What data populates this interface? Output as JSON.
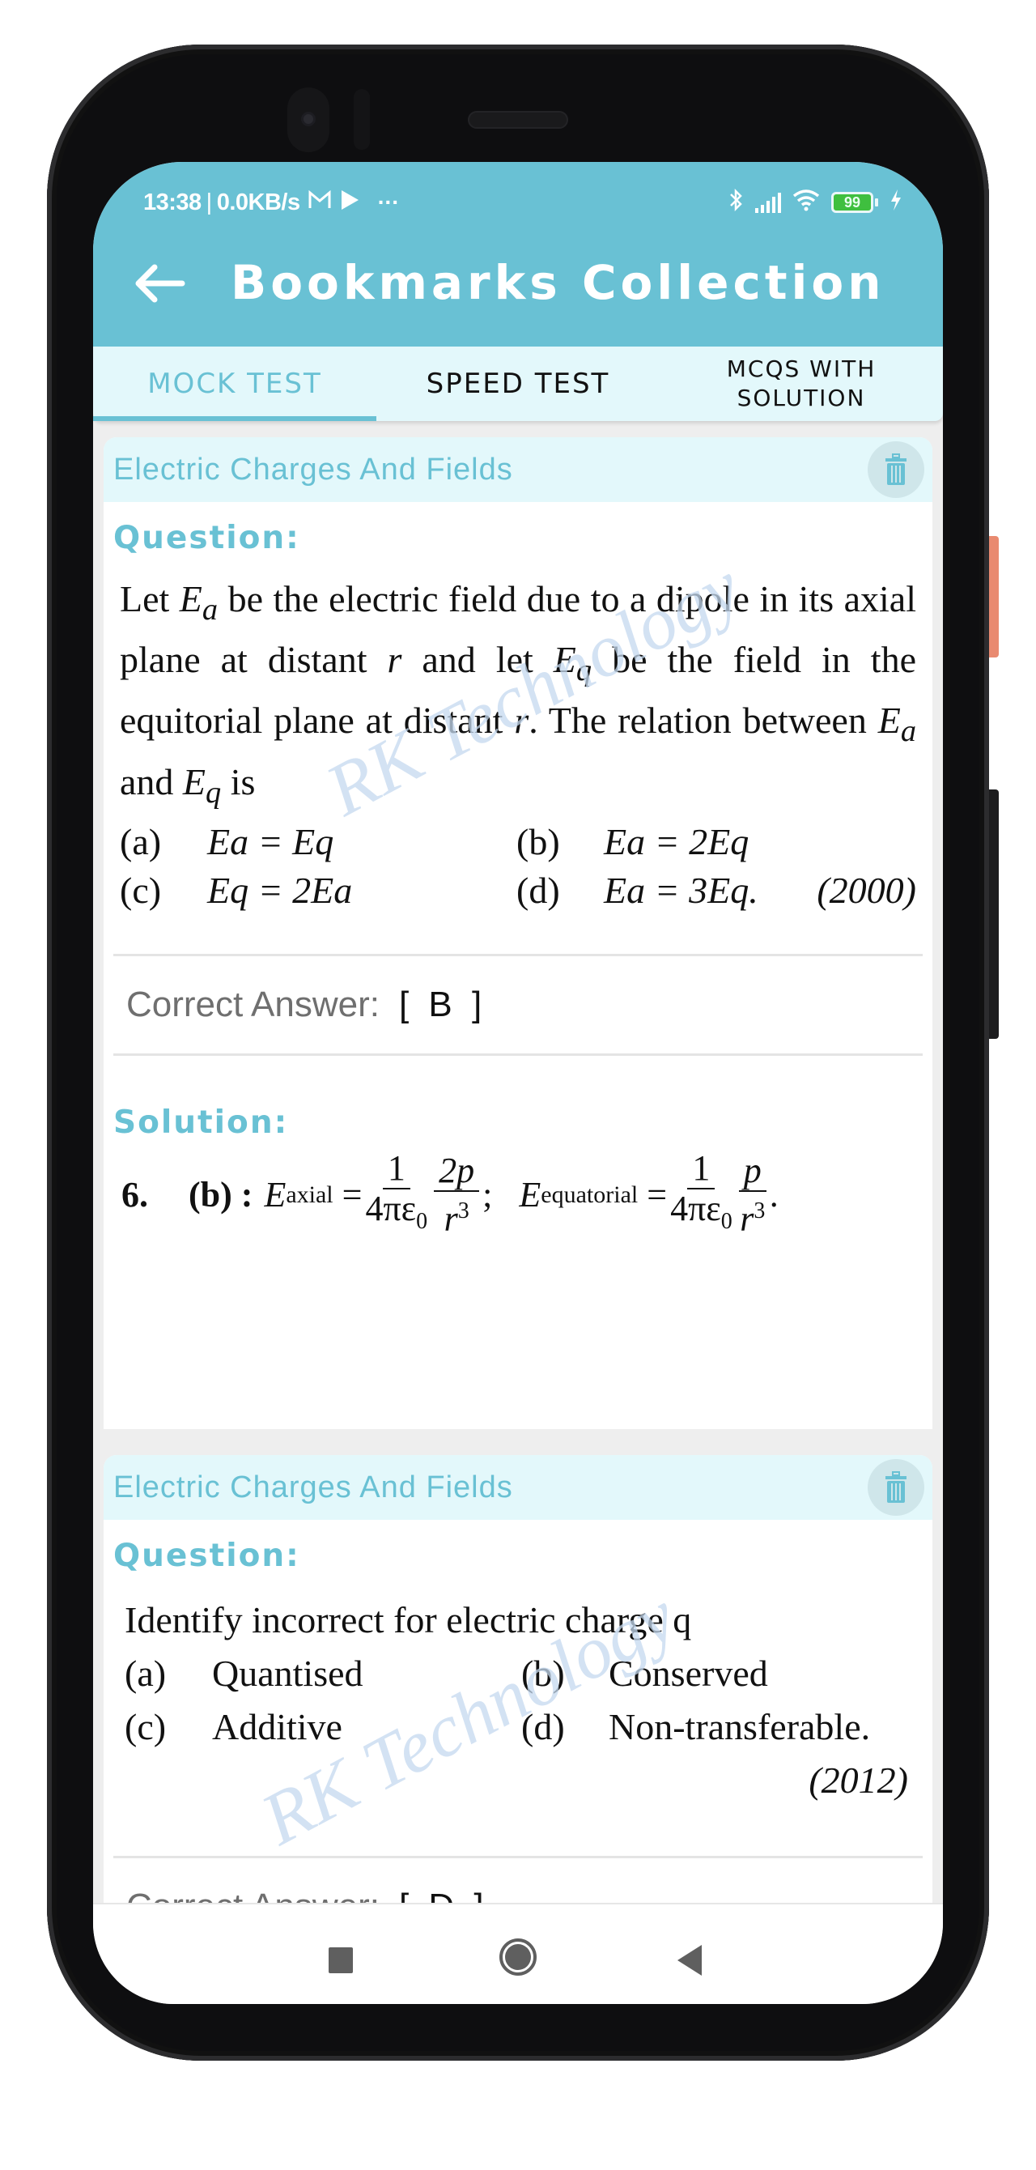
{
  "status_bar": {
    "time": "13:38",
    "net_speed": "0.0KB/s",
    "battery": "99",
    "more": "···"
  },
  "app_bar": {
    "title": "Bookmarks Collection",
    "back_icon": "arrow-left-icon"
  },
  "tabs": [
    {
      "label": "MOCK TEST",
      "active": true
    },
    {
      "label": "SPEED TEST",
      "active": false
    },
    {
      "label": "MCQS WITH SOLUTION",
      "active": false
    }
  ],
  "accent_color": "#69c1d4",
  "labels": {
    "question": "Question:",
    "solution": "Solution:",
    "correct_answer": "Correct Answer:"
  },
  "watermark": "RK Technology",
  "cards": [
    {
      "chapter": "Electric Charges And Fields",
      "question": {
        "segments": [
          "Let ",
          "E",
          "a",
          " be the electric field due to a dipole in its axial plane at distant ",
          "r",
          " and let ",
          "E",
          "q",
          " be the field in the equitorial plane at distant ",
          "r",
          ". The relation between ",
          "E",
          "a",
          " and ",
          "E",
          "q",
          " is"
        ],
        "options": [
          {
            "label": "(a)",
            "text": "Ea = Eq"
          },
          {
            "label": "(b)",
            "text": "Ea = 2Eq"
          },
          {
            "label": "(c)",
            "text": "Eq = 2Ea"
          },
          {
            "label": "(d)",
            "text": "Ea = 3Eq."
          }
        ],
        "year": "(2000)"
      },
      "correct_answer": "[ B ]",
      "solution": {
        "number": "6.",
        "answer": "(b) :",
        "text": "E_axial = (1/4πε0)(2p/r³); E_equatorial = (1/4πε0)(p/r³)."
      }
    },
    {
      "chapter": "Electric Charges And Fields",
      "question": {
        "text": "Identify incorrect for electric charge q",
        "options": [
          {
            "label": "(a)",
            "text": "Quantised"
          },
          {
            "label": "(b)",
            "text": "Conserved"
          },
          {
            "label": "(c)",
            "text": "Additive"
          },
          {
            "label": "(d)",
            "text": "Non-transferable."
          }
        ],
        "year": "(2012)"
      },
      "correct_answer": "[ D ]"
    }
  ],
  "nav_bar": [
    "recents-button",
    "home-button",
    "back-button"
  ]
}
